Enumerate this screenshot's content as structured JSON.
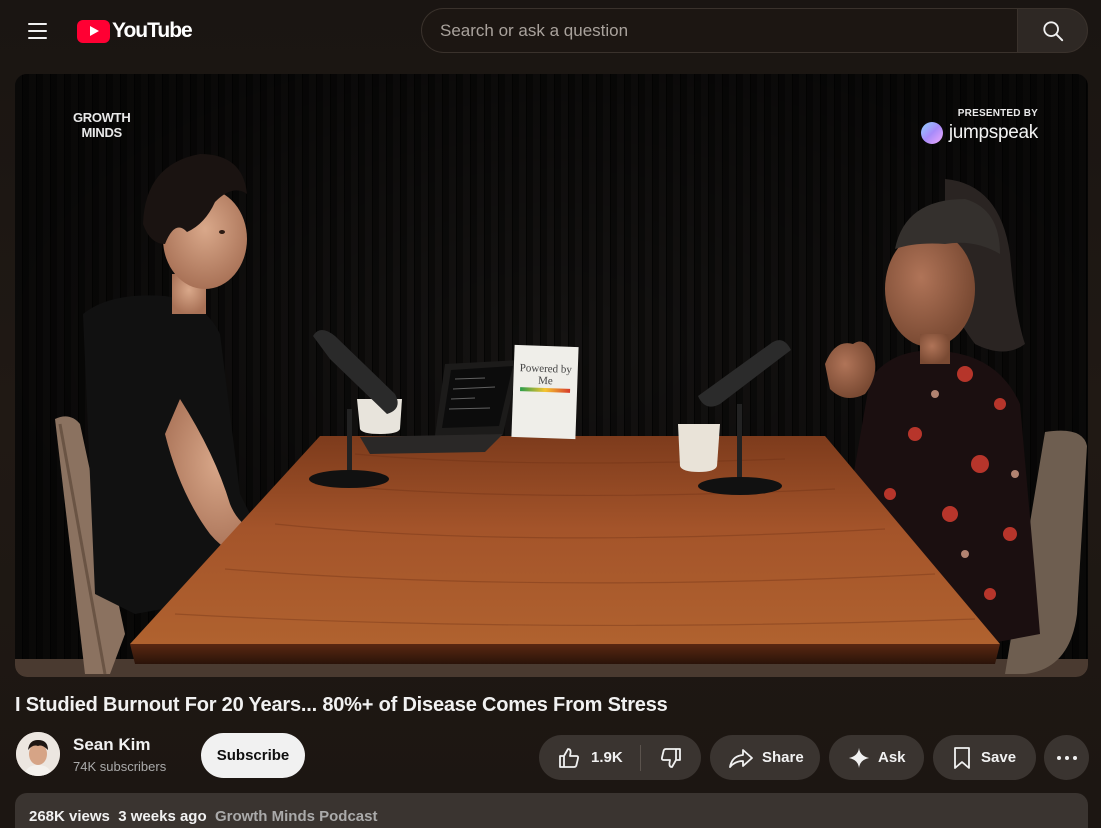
{
  "header": {
    "logo_text": "YouTube",
    "search_placeholder": "Search or ask a question"
  },
  "player": {
    "brand_left_line1": "GROWTH",
    "brand_left_line2": "MINDS",
    "presented_label": "PRESENTED BY",
    "sponsor_name": "jumpspeak",
    "book_title_line1": "Powered by",
    "book_title_line2": "Me"
  },
  "video": {
    "title": "I Studied Burnout For 20 Years... 80%+ of Disease Comes From Stress"
  },
  "channel": {
    "name": "Sean Kim",
    "subscribers": "74K subscribers",
    "subscribe_label": "Subscribe"
  },
  "actions": {
    "like_count": "1.9K",
    "share_label": "Share",
    "ask_label": "Ask",
    "save_label": "Save"
  },
  "description": {
    "views": "268K views",
    "date": "3 weeks ago",
    "channel_tag": "Growth Minds Podcast"
  },
  "icons": {
    "menu": "hamburger-menu-icon",
    "search": "search-icon",
    "like": "thumbs-up-icon",
    "dislike": "thumbs-down-icon",
    "share": "share-arrow-icon",
    "ask": "sparkle-icon",
    "save": "bookmark-icon",
    "more": "more-horizontal-icon"
  },
  "colors": {
    "brand_red": "#ff0033",
    "pill_bg": "#3a3430",
    "page_bg": "#1d1713"
  }
}
